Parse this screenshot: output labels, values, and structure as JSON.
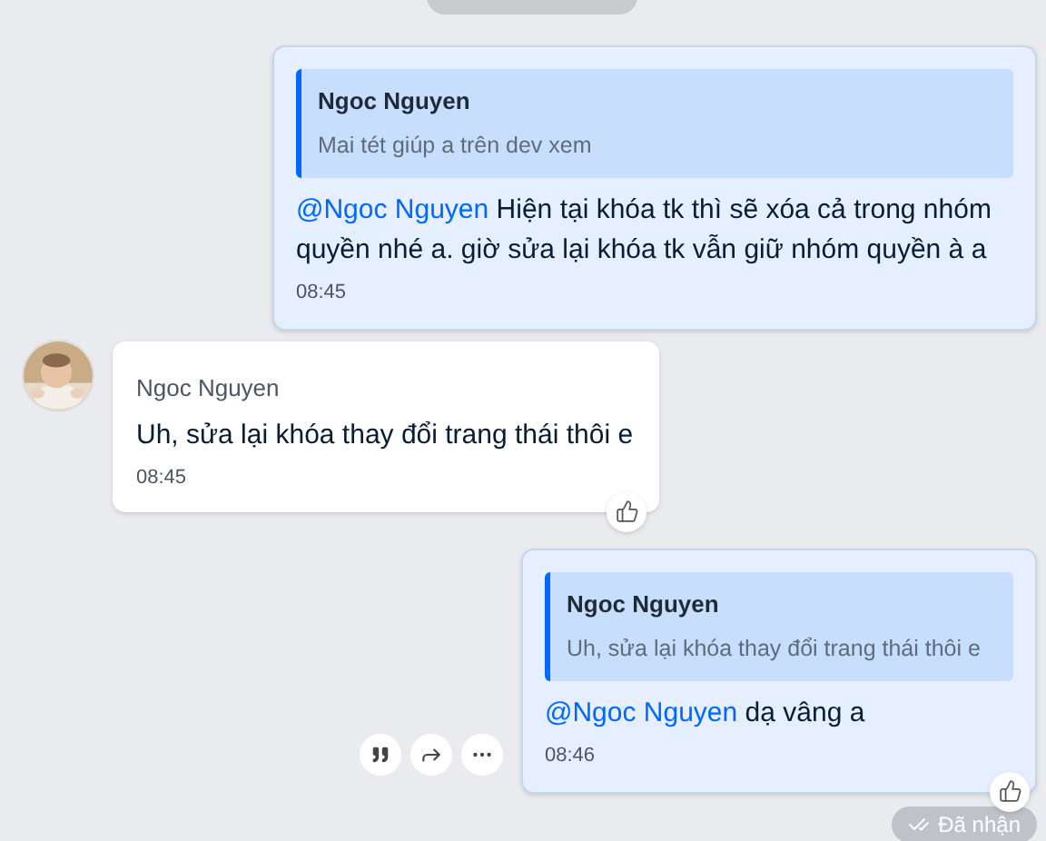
{
  "messages": [
    {
      "kind": "outgoing",
      "quote": {
        "author": "Ngoc Nguyen",
        "text": "Mai tét giúp a trên dev xem"
      },
      "mention": "@Ngoc Nguyen",
      "text": "Hiện tại khóa tk thì sẽ xóa cả trong nhóm quyền nhé a. giờ sửa lại khóa tk vẫn giữ nhóm quyền à a",
      "time": "08:45",
      "liked": false
    },
    {
      "kind": "incoming",
      "sender": "Ngoc Nguyen",
      "text": "Uh, sửa lại khóa thay đổi trang thái thôi e",
      "time": "08:45",
      "liked": true
    },
    {
      "kind": "outgoing",
      "quote": {
        "author": "Ngoc Nguyen",
        "text": "Uh, sửa lại khóa thay đổi trang thái thôi e"
      },
      "mention": "@Ngoc Nguyen",
      "text": "dạ vâng a",
      "time": "08:46",
      "liked": true,
      "actions": true
    }
  ],
  "status": "Đã nhận"
}
